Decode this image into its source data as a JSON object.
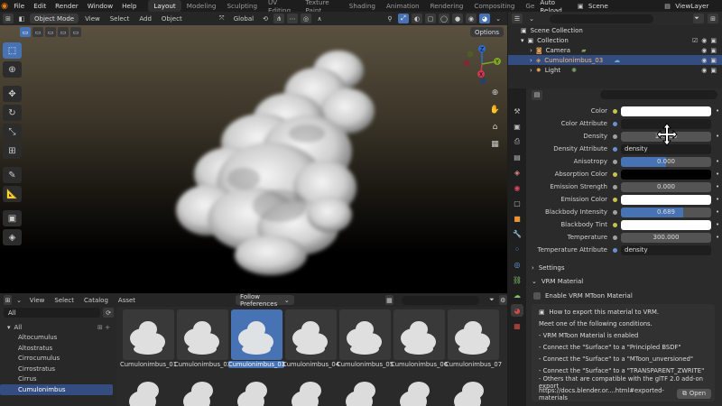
{
  "topbar": {
    "menus": [
      "File",
      "Edit",
      "Render",
      "Window",
      "Help"
    ],
    "workspaces": [
      "Layout",
      "Modeling",
      "Sculpting",
      "UV Editing",
      "Texture Paint",
      "Shading",
      "Animation",
      "Rendering",
      "Compositing",
      "Ge"
    ],
    "active_workspace": "Layout",
    "auto_reload": "Auto Reload",
    "scene": "Scene",
    "view_layer": "ViewLayer"
  },
  "viewport": {
    "mode": "Object Mode",
    "menus": [
      "View",
      "Select",
      "Add",
      "Object"
    ],
    "transform": "Global",
    "options": "Options",
    "gizmo": {
      "x": "X",
      "y": "Y",
      "z": "Z"
    }
  },
  "outliner": {
    "title": "Scene Collection",
    "items": [
      {
        "label": "Collection",
        "icon": "collection-icon"
      },
      {
        "label": "Camera",
        "icon": "camera-icon"
      },
      {
        "label": "Cumulonimbus_03",
        "icon": "volume-icon"
      },
      {
        "label": "Light",
        "icon": "light-icon"
      }
    ],
    "selected": "Cumulonimbus_03"
  },
  "properties": {
    "rows": [
      {
        "label": "Color",
        "kind": "white",
        "value": "",
        "dot": "#c9c34a"
      },
      {
        "label": "Color Attribute",
        "kind": "dark",
        "value": "",
        "dot": "#6d8fd1"
      },
      {
        "label": "Density",
        "kind": "num",
        "value": "10.000",
        "dot": "#a0a0a0",
        "fill": 0.0
      },
      {
        "label": "Density Attribute",
        "kind": "dark",
        "value": "density",
        "dot": "#6d8fd1"
      },
      {
        "label": "Anisotropy",
        "kind": "num",
        "value": "0.000",
        "dot": "#a0a0a0",
        "fill": 0.5
      },
      {
        "label": "Absorption Color",
        "kind": "black",
        "value": "",
        "dot": "#c9c34a"
      },
      {
        "label": "Emission Strength",
        "kind": "num",
        "value": "0.000",
        "dot": "#a0a0a0",
        "fill": 0.0
      },
      {
        "label": "Emission Color",
        "kind": "white",
        "value": "",
        "dot": "#c9c34a"
      },
      {
        "label": "Blackbody Intensity",
        "kind": "num",
        "value": "0.689",
        "dot": "#a0a0a0",
        "fill": 0.689
      },
      {
        "label": "Blackbody Tint",
        "kind": "white",
        "value": "",
        "dot": "#c9c34a"
      },
      {
        "label": "Temperature",
        "kind": "num",
        "value": "300.000",
        "dot": "#a0a0a0",
        "fill": 0.0
      },
      {
        "label": "Temperature Attribute",
        "kind": "dark",
        "value": "density",
        "dot": "#6d8fd1"
      }
    ],
    "settings": "Settings",
    "vrm_material": "VRM Material",
    "enable_vrm": "Enable VRM MToon Material",
    "vrm_lines": [
      "How to export this material to VRM.",
      "Meet one of the following conditions.",
      " - VRM MToon Material is enabled",
      " - Connect the \"Surface\" to a \"Principled BSDF\"",
      " - Connect the \"Surface\" to a \"MToon_unversioned\"",
      " - Connect the \"Surface\" to a \"TRANSPARENT_ZWRITE\"",
      " - Others that are compatible with the glTF 2.0 add-on export"
    ],
    "link": "https://docs.blender.or....html#exported-materials",
    "open": "Open"
  },
  "browser": {
    "menus": [
      "View",
      "Select",
      "Catalog",
      "Asset"
    ],
    "library": "Follow Preferences",
    "filter": "All",
    "catalogs": [
      "All",
      "Altocumulus",
      "Altostratus",
      "Cirrocumulus",
      "Cirrostratus",
      "Cirrus",
      "Cumulonimbus"
    ],
    "selected_catalog": "Cumulonimbus",
    "assets": [
      "Cumulonimbus_01",
      "Cumulonimbus_02",
      "Cumulonimbus_03",
      "Cumulonimbus_04",
      "Cumulonimbus_05",
      "Cumulonimbus_06",
      "Cumulonimbus_07"
    ],
    "selected_asset": "Cumulonimbus_03"
  }
}
